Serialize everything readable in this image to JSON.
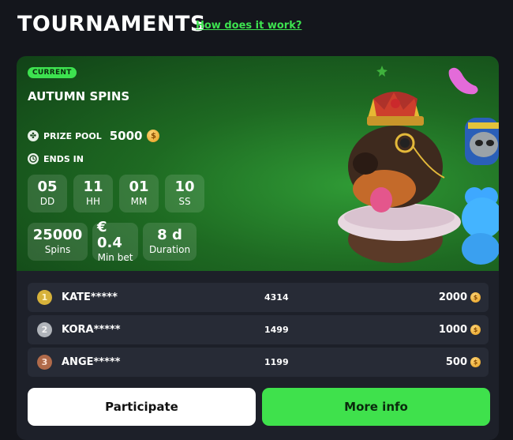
{
  "header": {
    "title": "TOURNAMENTS",
    "how_link": "How does it work?"
  },
  "tournament": {
    "status": "CURRENT",
    "name": "AUTUMN SPINS",
    "prize_pool_label": "PRIZE POOL",
    "prize_pool_value": "5000",
    "ends_label": "ENDS IN",
    "timer": [
      {
        "value": "05",
        "unit": "DD"
      },
      {
        "value": "11",
        "unit": "HH"
      },
      {
        "value": "01",
        "unit": "MM"
      },
      {
        "value": "10",
        "unit": "SS"
      }
    ],
    "stats": [
      {
        "value": "25000",
        "label": "Spins"
      },
      {
        "value": "€ 0.4",
        "label": "Min bet"
      },
      {
        "value": "8 d",
        "label": "Duration"
      }
    ]
  },
  "leaderboard": [
    {
      "rank": "1",
      "name": "KATE*****",
      "score": "4314",
      "prize": "2000"
    },
    {
      "rank": "2",
      "name": "KORA*****",
      "score": "1499",
      "prize": "1000"
    },
    {
      "rank": "3",
      "name": "ANGE*****",
      "score": "1199",
      "prize": "500"
    }
  ],
  "buttons": {
    "participate": "Participate",
    "more_info": "More info"
  },
  "colors": {
    "accent_green": "#3de24f",
    "background": "#14161c",
    "panel": "#1d2029",
    "coin": "#e59b19"
  },
  "icons": {
    "prize": "clover-icon",
    "clock": "clock-icon",
    "coin": "coin-icon"
  }
}
